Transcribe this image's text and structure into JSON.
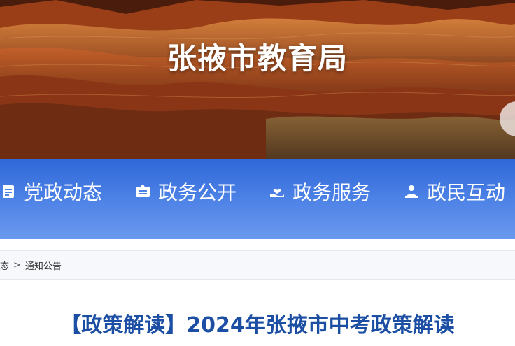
{
  "header": {
    "site_title": "张掖市教育局"
  },
  "nav": {
    "items": [
      {
        "label": "党政动态",
        "icon": "document-icon"
      },
      {
        "label": "政务公开",
        "icon": "id-card-icon"
      },
      {
        "label": "政务服务",
        "icon": "hand-heart-icon"
      },
      {
        "label": "政民互动",
        "icon": "person-icon"
      }
    ]
  },
  "breadcrumb": {
    "prev": "态",
    "separator": ">",
    "current": "通知公告"
  },
  "article": {
    "title": "【政策解读】2024年张掖市中考政策解读"
  },
  "colors": {
    "nav_top": "#2f68d8",
    "nav_bottom": "#6a98ee",
    "title_blue": "#1c4fa3"
  }
}
